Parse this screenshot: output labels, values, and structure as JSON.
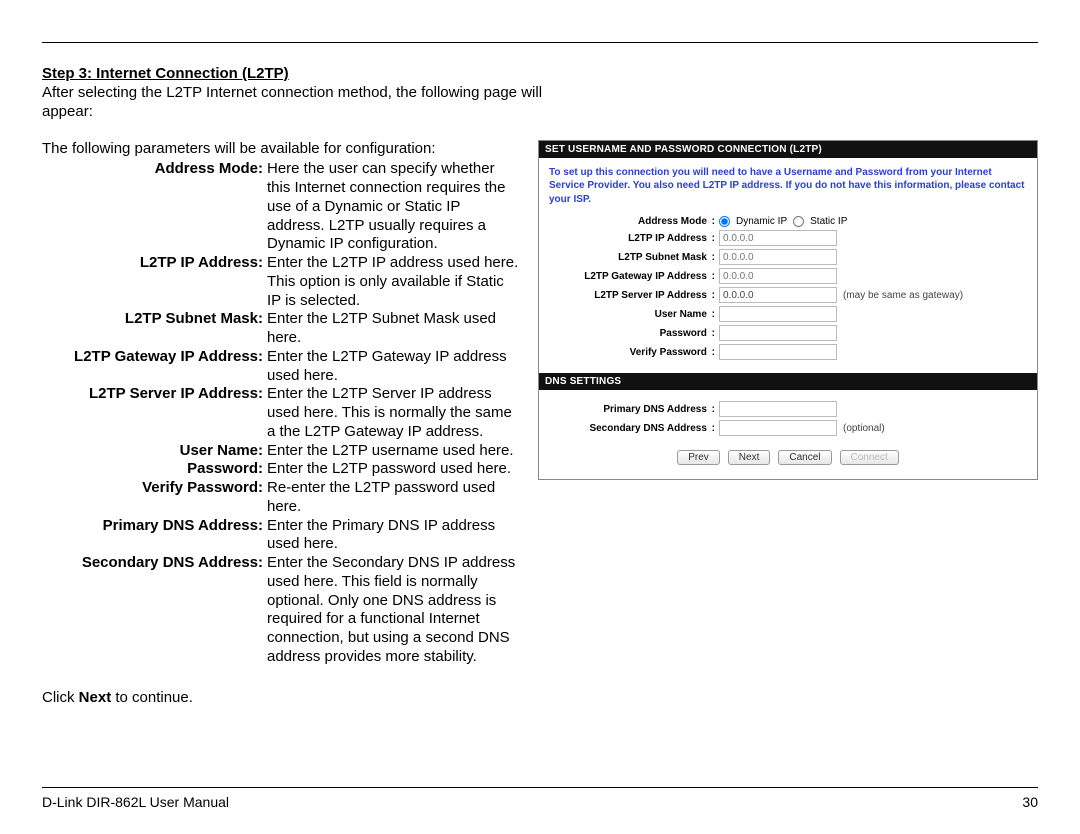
{
  "title": "Step 3: Internet Connection (L2TP)",
  "intro": "After selecting the L2TP Internet connection method, the following page will appear:",
  "params_intro": "The following parameters will be available for configuration:",
  "defs": {
    "address_mode": {
      "label": "Address Mode:",
      "text": "Here the user can specify whether this Internet connection requires the use of a Dynamic or Static IP address. L2TP usually requires a Dynamic IP configuration."
    },
    "l2tp_ip": {
      "label": "L2TP IP Address:",
      "text": "Enter the L2TP IP address used here. This option is only available if Static IP is selected."
    },
    "l2tp_subnet": {
      "label": "L2TP Subnet Mask:",
      "text": "Enter the L2TP Subnet Mask used here."
    },
    "l2tp_gateway": {
      "label": "L2TP Gateway IP Address:",
      "text": "Enter the L2TP Gateway IP address used here."
    },
    "l2tp_server": {
      "label": "L2TP Server IP Address:",
      "text": "Enter the L2TP Server IP address used here. This is normally the same a the L2TP Gateway IP address."
    },
    "username": {
      "label": "User Name:",
      "text": "Enter the L2TP username used here."
    },
    "password": {
      "label": "Password:",
      "text": "Enter the L2TP password used here."
    },
    "verify_password": {
      "label": "Verify Password:",
      "text": "Re-enter the L2TP password used here."
    },
    "primary_dns": {
      "label": "Primary DNS Address:",
      "text": "Enter the Primary DNS IP address used here."
    },
    "secondary_dns": {
      "label": "Secondary DNS Address:",
      "text": "Enter the Secondary DNS IP address used here. This field is normally optional. Only one DNS address is required for a functional Internet connection, but using a second DNS address provides more stability."
    }
  },
  "click_next_prefix": "Click ",
  "click_next_bold": "Next",
  "click_next_suffix": " to continue.",
  "panel": {
    "header1": "SET USERNAME AND PASSWORD CONNECTION (L2TP)",
    "info": "To set up this connection you will need to have a Username and Password from your Internet Service Provider. You also need L2TP IP address. If you do not have this information, please contact your ISP.",
    "labels": {
      "address_mode": "Address Mode",
      "l2tp_ip": "L2TP IP Address",
      "l2tp_subnet": "L2TP Subnet Mask",
      "l2tp_gateway": "L2TP Gateway IP Address",
      "l2tp_server": "L2TP Server IP Address",
      "server_hint": "(may be same as gateway)",
      "username": "User Name",
      "password": "Password",
      "verify_password": "Verify Password",
      "dynamic_ip": "Dynamic IP",
      "static_ip": "Static IP"
    },
    "placeholders": {
      "ip": "0.0.0.0",
      "server": "0.0.0.0"
    },
    "header2": "DNS SETTINGS",
    "dns": {
      "primary": "Primary DNS Address",
      "secondary": "Secondary DNS Address",
      "optional": "(optional)"
    },
    "buttons": {
      "prev": "Prev",
      "next": "Next",
      "cancel": "Cancel",
      "connect": "Connect"
    },
    "colon": " :"
  },
  "footer": {
    "left": "D-Link DIR-862L User Manual",
    "right": "30"
  }
}
